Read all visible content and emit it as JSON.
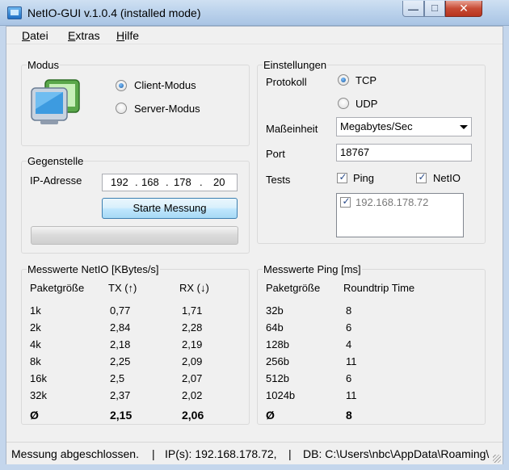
{
  "window": {
    "title": "NetIO-GUI v.1.0.4 (installed mode)"
  },
  "menu": {
    "datei": "atei",
    "datei_u": "D",
    "extras": "xtras",
    "extras_u": "E",
    "hilfe": "ilfe",
    "hilfe_u": "H"
  },
  "modus": {
    "label": "Modus",
    "client": "Client-Modus",
    "server": "Server-Modus",
    "client_selected": true
  },
  "einstellungen": {
    "label": "Einstellungen",
    "protokoll_label": "Protokoll",
    "tcp": "TCP",
    "udp": "UDP",
    "masseinheit_label": "Maßeinheit",
    "masseinheit_value": "Megabytes/Sec",
    "port_label": "Port",
    "port_value": "18767",
    "tests_label": "Tests",
    "ping": "Ping",
    "netio": "NetIO",
    "hosts": [
      "192.168.178.72"
    ]
  },
  "gegenstelle": {
    "label": "Gegenstelle",
    "ip_label": "IP-Adresse",
    "ip": [
      "192",
      "168",
      "178",
      "20"
    ],
    "ip_sep": ".",
    "start_button": "Starte Messung"
  },
  "netio": {
    "label": "Messwerte NetIO [KBytes/s]",
    "headers": [
      "Paketgröße",
      "TX (↑)",
      "RX (↓)"
    ],
    "rows": [
      [
        "1k",
        "0,77",
        "1,71"
      ],
      [
        "2k",
        "2,84",
        "2,28"
      ],
      [
        "4k",
        "2,18",
        "2,19"
      ],
      [
        "8k",
        "2,25",
        "2,09"
      ],
      [
        "16k",
        "2,5",
        "2,07"
      ],
      [
        "32k",
        "2,37",
        "2,02"
      ]
    ],
    "summary": [
      "Ø",
      "2,15",
      "2,06"
    ]
  },
  "ping": {
    "label": "Messwerte Ping [ms]",
    "headers": [
      "Paketgröße",
      "Roundtrip Time"
    ],
    "rows": [
      [
        "32b",
        "8"
      ],
      [
        "64b",
        "6"
      ],
      [
        "128b",
        "4"
      ],
      [
        "256b",
        "11"
      ],
      [
        "512b",
        "6"
      ],
      [
        "1024b",
        "11"
      ]
    ],
    "summary": [
      "Ø",
      "8"
    ]
  },
  "status": {
    "message": "Messung abgeschlossen.",
    "sep": "|",
    "ips": "IP(s): 192.168.178.72,",
    "db": "DB: C:\\Users\\nbc\\AppData\\Roaming\\"
  }
}
